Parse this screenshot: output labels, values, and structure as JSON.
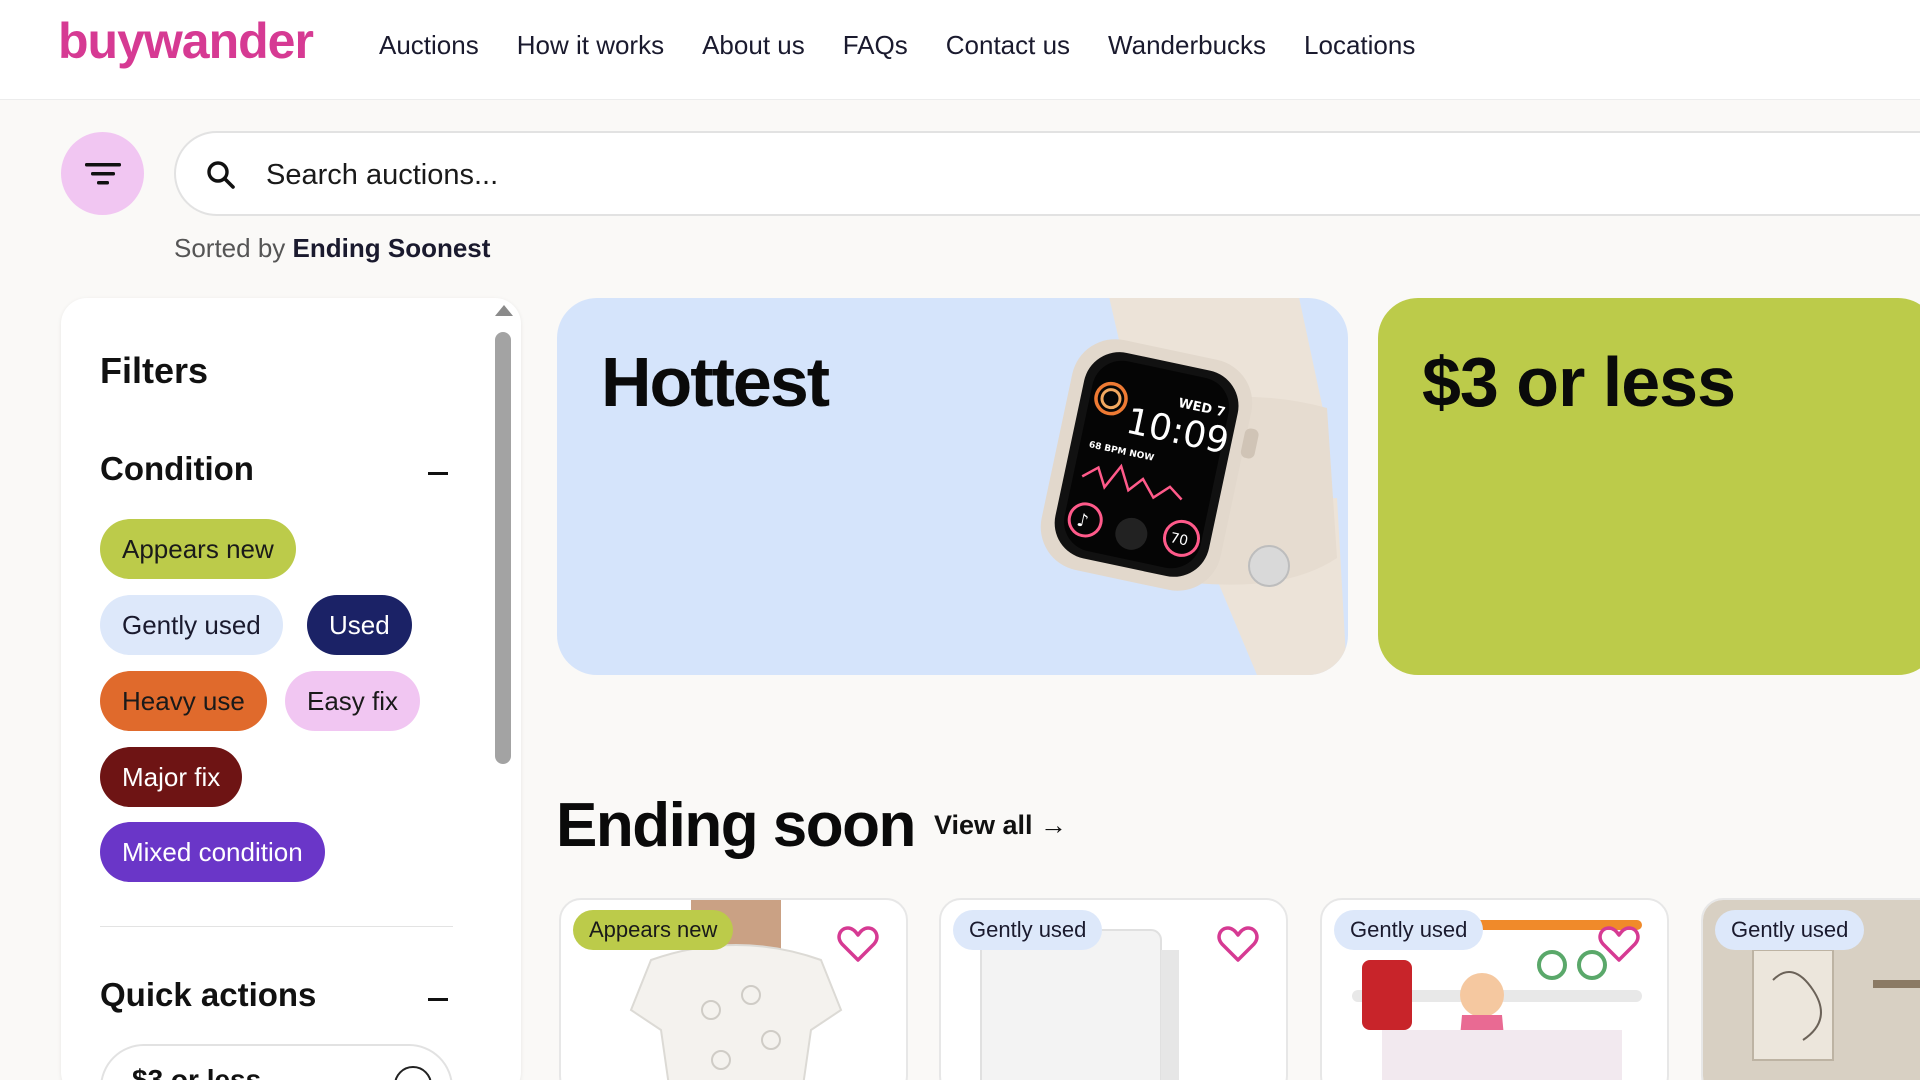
{
  "header": {
    "logo": "buywander",
    "nav": [
      "Auctions",
      "How it works",
      "About us",
      "FAQs",
      "Contact us",
      "Wanderbucks",
      "Locations"
    ]
  },
  "search": {
    "placeholder": "Search auctions...",
    "sorted_prefix": "Sorted by",
    "sorted_value": "Ending Soonest"
  },
  "sidebar": {
    "title": "Filters",
    "condition": {
      "title": "Condition",
      "chips": [
        "Appears new",
        "Gently used",
        "Used",
        "Heavy use",
        "Easy fix",
        "Major fix",
        "Mixed condition"
      ]
    },
    "quick_actions": {
      "title": "Quick actions",
      "first_option": "$3 or less"
    }
  },
  "banners": [
    {
      "title": "Hottest",
      "color": "#d5e4fb"
    },
    {
      "title": "$3 or less",
      "color": "#bccb4a"
    }
  ],
  "ending_soon": {
    "title": "Ending soon",
    "view_all": "View all →",
    "cards": [
      {
        "badge": "Appears new"
      },
      {
        "badge": "Gently used"
      },
      {
        "badge": "Gently used"
      },
      {
        "badge": "Gently used"
      }
    ]
  },
  "watch": {
    "day": "WED 7",
    "time": "10:09",
    "bpm": "68 BPM NOW",
    "complication": "70"
  },
  "colors": {
    "brand": "#d63a93",
    "appears_new": "#bccb4a",
    "gently_used": "#dde8fa",
    "used": "#1b2266",
    "heavy_use": "#e06a2c",
    "easy_fix": "#f1c6f2",
    "major_fix": "#6e1414",
    "mixed_condition": "#6a36c8"
  }
}
